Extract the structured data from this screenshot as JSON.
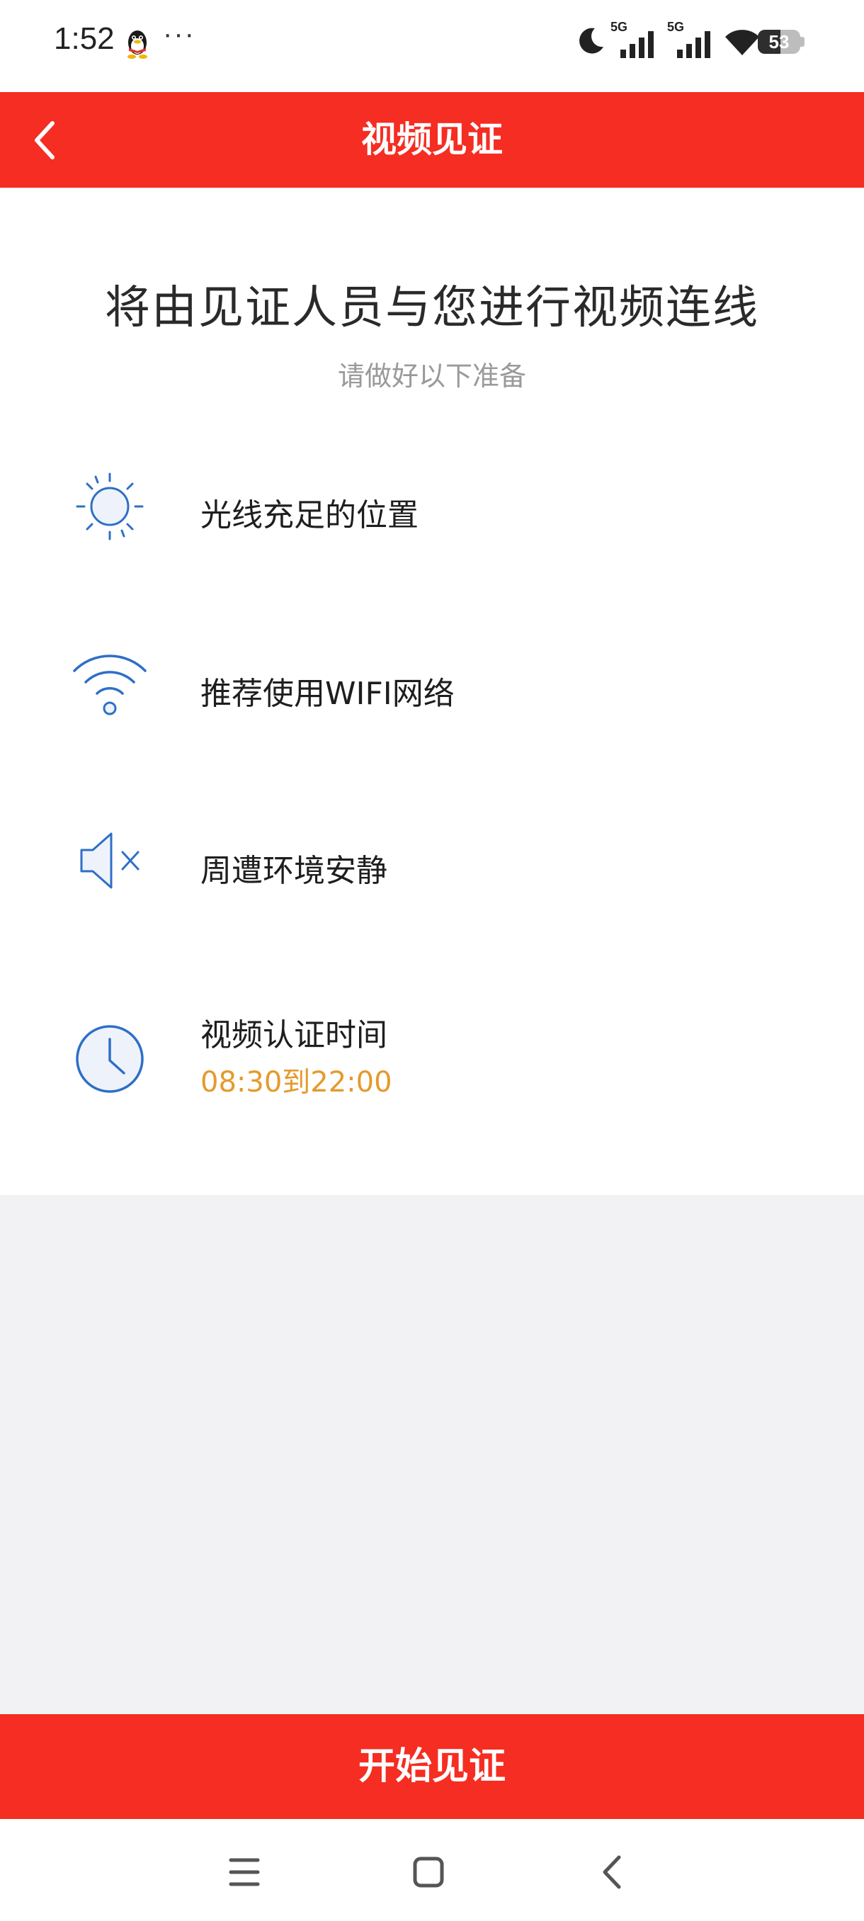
{
  "status_bar": {
    "time": "1:52",
    "more_indicator": "···",
    "network_1": "5G",
    "network_2": "5G",
    "battery_level": "53",
    "battery_fraction": 0.53
  },
  "app_bar": {
    "title": "视频见证",
    "background_color": "#f52d22"
  },
  "main": {
    "headline": "将由见证人员与您进行视频连线",
    "subheadline": "请做好以下准备",
    "items": [
      {
        "icon": "sun-icon",
        "label": "光线充足的位置"
      },
      {
        "icon": "wifi-icon",
        "label": "推荐使用WIFI网络"
      },
      {
        "icon": "speaker-mute-icon",
        "label": "周遭环境安静"
      },
      {
        "icon": "clock-icon",
        "label": "视频认证时间",
        "sub_label": "08:30到22:00",
        "sub_label_color": "#e59a2c"
      }
    ],
    "icon_color": "#2e6fc7"
  },
  "footer": {
    "start_button_label": "开始见证"
  },
  "nav_bar": {
    "buttons": [
      "menu-icon",
      "home-icon",
      "back-icon"
    ]
  }
}
